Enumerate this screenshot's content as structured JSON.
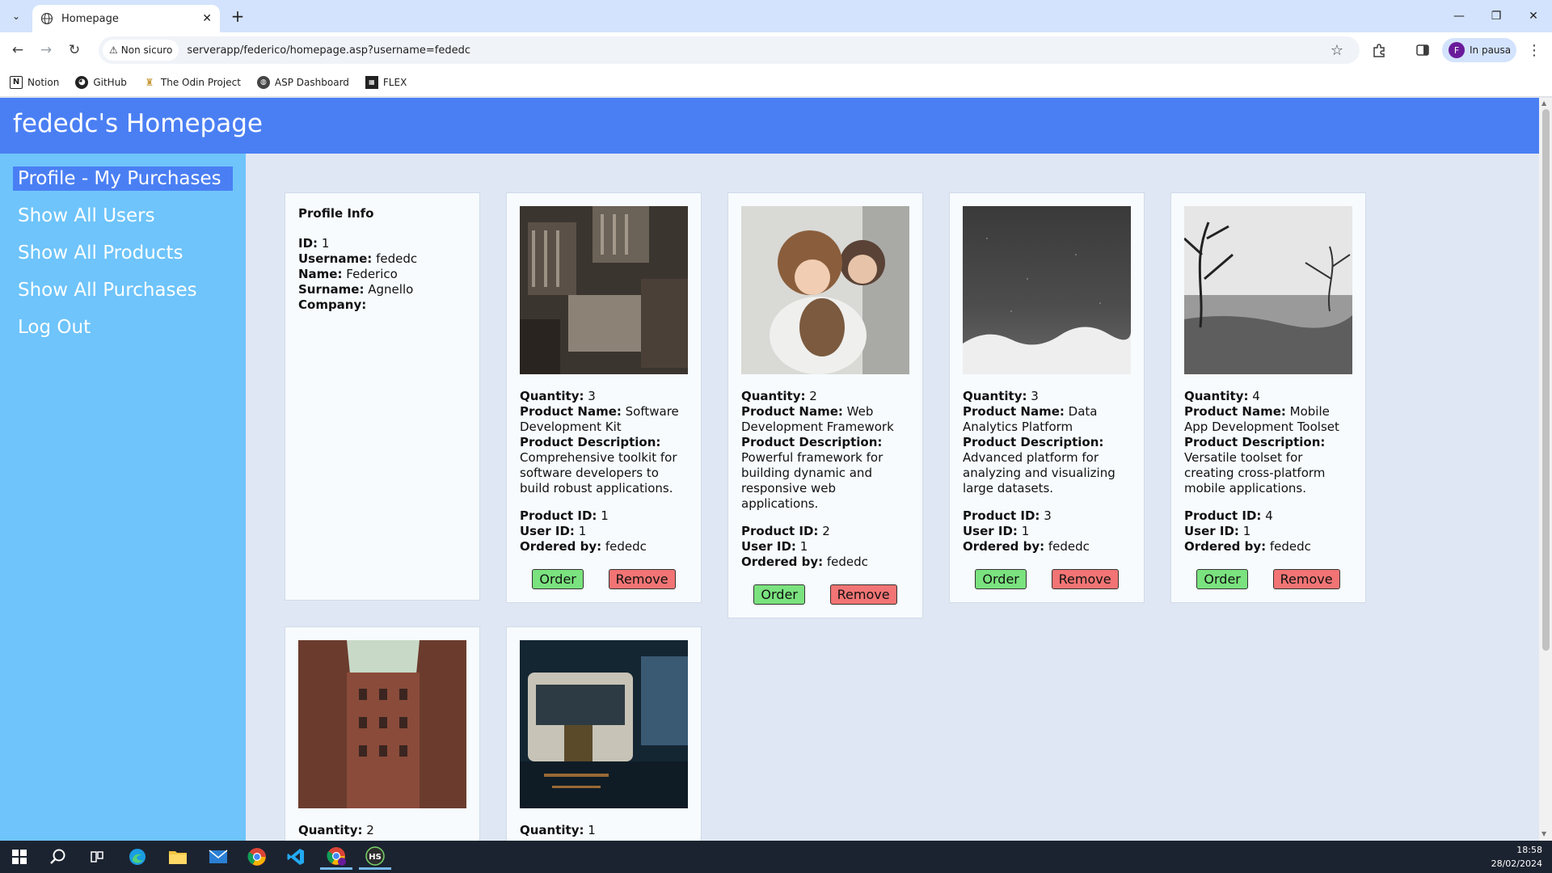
{
  "browser": {
    "tab_title": "Homepage",
    "address_status": "Non sicuro",
    "url": "serverapp/federico/homepage.asp?username=fededc",
    "profile_initial": "F",
    "profile_status": "In pausa",
    "bookmarks": [
      "Notion",
      "GitHub",
      "The Odin Project",
      "ASP Dashboard",
      "FLEX"
    ]
  },
  "page": {
    "title": "fededc's Homepage",
    "nav": [
      "Profile - My Purchases",
      "Show All Users",
      "Show All Products",
      "Show All Purchases",
      "Log Out"
    ]
  },
  "profile": {
    "heading": "Profile Info",
    "id_label": "ID:",
    "id": "1",
    "username_label": "Username:",
    "username": "fededc",
    "name_label": "Name:",
    "name": "Federico",
    "surname_label": "Surname:",
    "surname": "Agnello",
    "company_label": "Company:",
    "company": ""
  },
  "labels": {
    "quantity": "Quantity:",
    "product_name": "Product Name:",
    "product_description": "Product Description:",
    "product_id": "Product ID:",
    "user_id": "User ID:",
    "ordered_by": "Ordered by:",
    "order_button": "Order",
    "remove_button": "Remove"
  },
  "purchases": [
    {
      "quantity": "3",
      "name": "Software Development Kit",
      "description": "Comprehensive toolkit for software developers to build robust applications.",
      "product_id": "1",
      "user_id": "1",
      "ordered_by": "fededc"
    },
    {
      "quantity": "2",
      "name": "Web Development Framework",
      "description": "Powerful framework for building dynamic and responsive web applications.",
      "product_id": "2",
      "user_id": "1",
      "ordered_by": "fededc"
    },
    {
      "quantity": "3",
      "name": "Data Analytics Platform",
      "description": "Advanced platform for analyzing and visualizing large datasets.",
      "product_id": "3",
      "user_id": "1",
      "ordered_by": "fededc"
    },
    {
      "quantity": "4",
      "name": "Mobile App Development Toolset",
      "description": "Versatile toolset for creating cross-platform mobile applications.",
      "product_id": "4",
      "user_id": "1",
      "ordered_by": "fededc"
    },
    {
      "quantity": "2"
    },
    {
      "quantity": "1"
    }
  ],
  "taskbar": {
    "time": "18:58",
    "date": "28/02/2024"
  }
}
